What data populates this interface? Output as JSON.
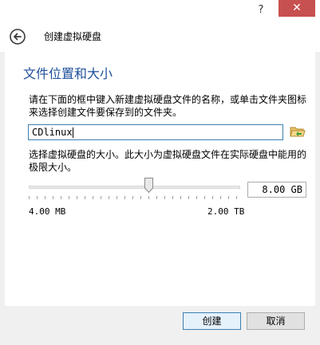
{
  "window": {
    "help_label": "?",
    "close_label": "✕"
  },
  "header": {
    "title": "创建虚拟硬盘"
  },
  "section": {
    "title": "文件位置和大小",
    "location_description": "请在下面的框中键入新建虚拟硬盘文件的名称，或单击文件夹图标来选择创建文件要保存到的文件夹。",
    "filename_value": "CDlinux",
    "size_description": "选择虚拟硬盘的大小。此大小为虚拟硬盘文件在实际硬盘中能用的极限大小。",
    "size_value": "8.00 GB",
    "min_label": "4.00 MB",
    "max_label": "2.00 TB",
    "slider_fraction": 0.57
  },
  "footer": {
    "create_label": "创建",
    "cancel_label": "取消"
  },
  "colors": {
    "section_title": "#1e4f9b",
    "close_button": "#c75050",
    "focus_border": "#3c7fb1"
  },
  "icons": {
    "back": "back-arrow-icon",
    "folder": "folder-open-icon",
    "help": "help-icon",
    "close": "close-icon"
  }
}
